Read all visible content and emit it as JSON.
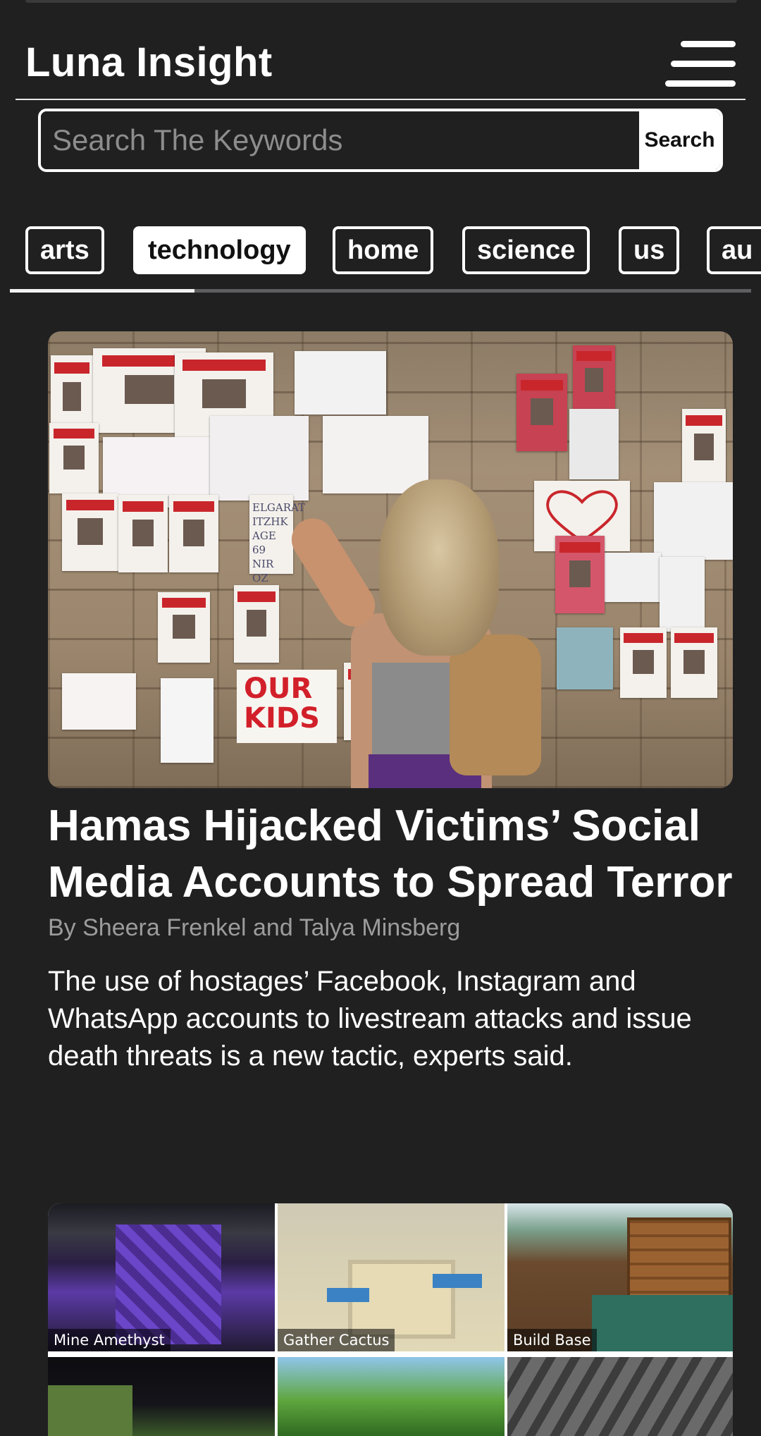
{
  "header": {
    "title": "Luna Insight",
    "menu_icon": "hamburger-menu-icon"
  },
  "search": {
    "placeholder": "Search The Keywords",
    "value": "",
    "button_label": "Search"
  },
  "tabs": [
    {
      "label": "arts",
      "active": false
    },
    {
      "label": "technology",
      "active": true
    },
    {
      "label": "home",
      "active": false
    },
    {
      "label": "science",
      "active": false
    },
    {
      "label": "us",
      "active": false
    },
    {
      "label": "au",
      "active": false
    }
  ],
  "articles": [
    {
      "image_labels": [
        "KIDNAPPED",
        "ELGARAT ITZHK AGE 69 NIR OZ",
        "OUR KIDS"
      ],
      "headline": "Hamas Hijacked Victims’ Social Media Accounts to Spread Terror",
      "byline": "By Sheera Frenkel and Talya Minsberg",
      "summary": "The use of hostages’ Facebook, Instagram and WhatsApp accounts to livestream attacks and issue death threats is a new tactic, experts said."
    },
    {
      "tiles": [
        {
          "label": "Mine Amethyst"
        },
        {
          "label": "Gather Cactus"
        },
        {
          "label": "Build Base"
        },
        {
          "label": ""
        },
        {
          "label": ""
        },
        {
          "label": ""
        }
      ]
    }
  ],
  "colors": {
    "background": "#202021",
    "text": "#ffffff",
    "muted_text": "#9c9c9c",
    "accent_red": "#c9262c"
  }
}
